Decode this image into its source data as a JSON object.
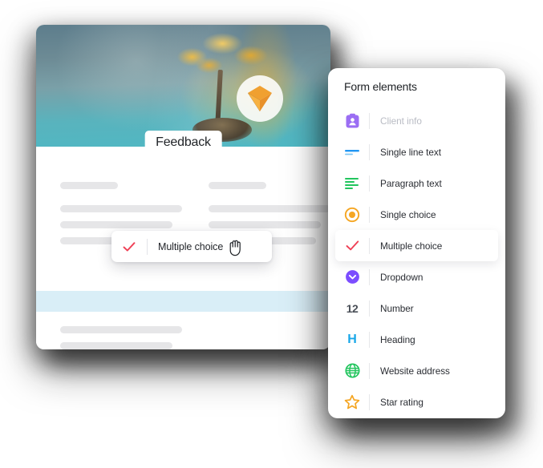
{
  "form_card": {
    "hero": {
      "logo_icon": "orange-pyramid-logo",
      "title": "Feedback",
      "background_image": "tree-on-island-teal-water",
      "banner_colors": [
        "#5d7d8c",
        "#7aa0a8",
        "#4fb8c4"
      ]
    },
    "skeleton": {
      "left_column": [
        "title",
        "line",
        "line",
        "line"
      ],
      "right_column": [
        "title",
        "line",
        "line",
        "line"
      ],
      "lower_column": [
        "line",
        "line",
        "line"
      ],
      "bar_color": "#e6e6e8"
    },
    "dropzone": {
      "color": "#d9eef7",
      "label": ""
    }
  },
  "drag_chip": {
    "icon": "check-icon",
    "icon_color": "#ef4056",
    "label": "Multiple choice",
    "cursor": "grab-hand-cursor"
  },
  "panel": {
    "title": "Form elements",
    "items": [
      {
        "icon": "client-info-badge-icon",
        "color": "#9b6ef3",
        "label": "Client info",
        "disabled": true
      },
      {
        "icon": "single-line-text-icon",
        "color": "#2196f3",
        "label": "Single line text",
        "disabled": false
      },
      {
        "icon": "paragraph-text-icon",
        "color": "#22c55e",
        "label": "Paragraph text",
        "disabled": false
      },
      {
        "icon": "single-choice-radio-icon",
        "color": "#f5a623",
        "label": "Single choice",
        "disabled": false
      },
      {
        "icon": "multiple-choice-check-icon",
        "color": "#ef4056",
        "label": "Multiple choice",
        "disabled": false
      },
      {
        "icon": "dropdown-chevron-icon",
        "color": "#7c4dff",
        "label": "Dropdown",
        "disabled": false
      },
      {
        "icon": "number-12-icon",
        "color": "#4a4f57",
        "label": "Number",
        "disabled": false
      },
      {
        "icon": "heading-h-icon",
        "color": "#19a7e8",
        "label": "Heading",
        "disabled": false
      },
      {
        "icon": "website-address-globe-icon",
        "color": "#22c55e",
        "label": "Website address",
        "disabled": false
      },
      {
        "icon": "star-rating-icon",
        "color": "#f5a623",
        "label": "Star rating",
        "disabled": false
      }
    ]
  }
}
